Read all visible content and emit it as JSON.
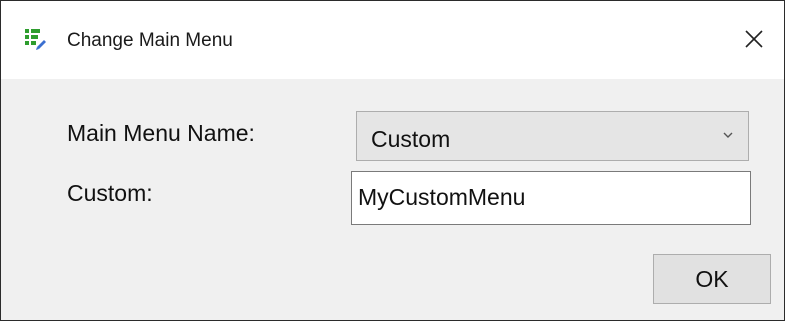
{
  "window": {
    "title": "Change Main Menu",
    "icon": "menu-edit-icon",
    "close_icon": "close-icon"
  },
  "form": {
    "main_menu_name_label": "Main Menu Name:",
    "main_menu_name_value": "Custom",
    "custom_label": "Custom:",
    "custom_value": "MyCustomMenu"
  },
  "buttons": {
    "ok_label": "OK"
  },
  "colors": {
    "icon_green": "#2e9d2e",
    "icon_blue": "#3b6fd0"
  }
}
